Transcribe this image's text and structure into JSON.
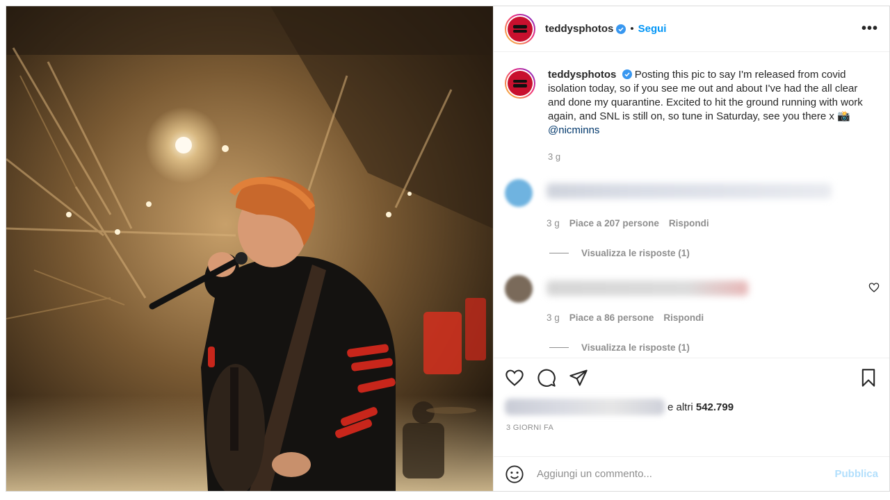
{
  "post": {
    "username": "teddysphotos",
    "dot": "•",
    "follow_label": "Segui",
    "more_label": "•••",
    "caption_text": "Posting this pic to say I'm released from covid isolation today, so if you see me out and about I've had the all clear and done my quarantine. Excited to hit the ground running with work again, and SNL is still on, so tune in Saturday, see you there x 📸",
    "caption_mention": "@nicminns",
    "caption_time": "3 g"
  },
  "comments": [
    {
      "time": "3 g",
      "likes": "Piace a 207 persone",
      "reply": "Rispondi",
      "view_replies": "Visualizza le risposte (1)"
    },
    {
      "time": "3 g",
      "likes": "Piace a 86 persone",
      "reply": "Rispondi",
      "view_replies": "Visualizza le risposte (1)"
    }
  ],
  "likes": {
    "suffix": "e altri",
    "count": "542.799"
  },
  "time_ago": "3 GIORNI FA",
  "add_comment": {
    "placeholder": "Aggiungi un commento...",
    "publish": "Pubblica"
  },
  "colors": {
    "accent": "#0095f6",
    "secondary_text": "#8e8e8e",
    "mention": "#00376b"
  },
  "icons": [
    "verified-badge-icon",
    "more-options-icon",
    "heart-icon",
    "comment-icon",
    "share-icon",
    "bookmark-icon",
    "emoji-icon"
  ]
}
